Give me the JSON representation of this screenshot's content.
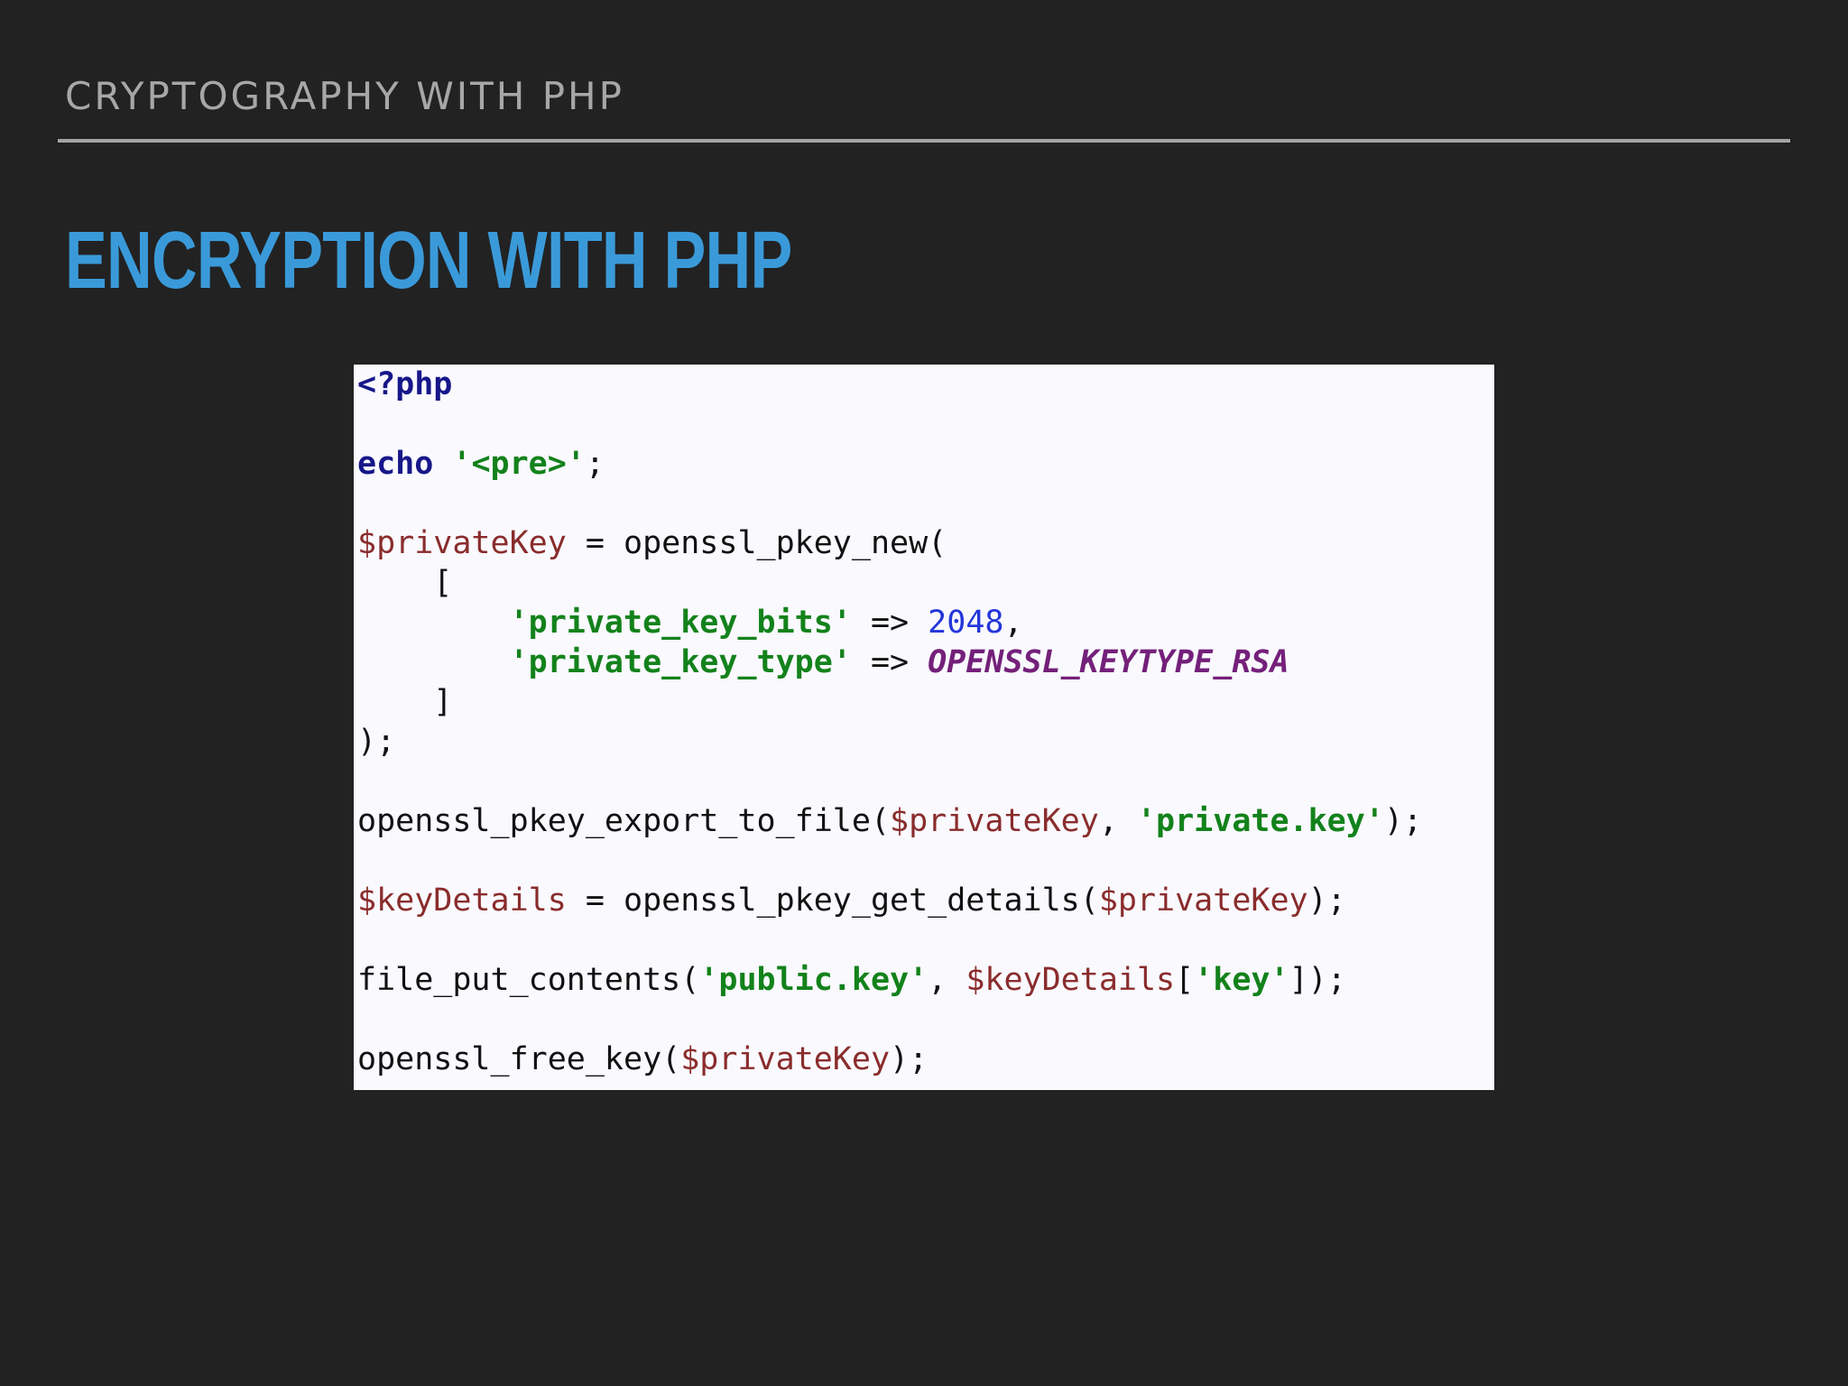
{
  "header": {
    "title": "CRYPTOGRAPHY WITH PHP"
  },
  "slide": {
    "title": "ENCRYPTION WITH PHP"
  },
  "code": {
    "language": "php",
    "lines": [
      [
        {
          "t": "<?php",
          "c": "kw"
        }
      ],
      [],
      [
        {
          "t": "echo",
          "c": "kw"
        },
        {
          "t": " ",
          "c": ""
        },
        {
          "t": "'<pre>'",
          "c": "str"
        },
        {
          "t": ";",
          "c": ""
        }
      ],
      [],
      [
        {
          "t": "$privateKey",
          "c": "var"
        },
        {
          "t": " = openssl_pkey_new(",
          "c": ""
        }
      ],
      [
        {
          "t": "    [",
          "c": ""
        }
      ],
      [
        {
          "t": "        ",
          "c": ""
        },
        {
          "t": "'private_key_bits'",
          "c": "str"
        },
        {
          "t": " => ",
          "c": ""
        },
        {
          "t": "2048",
          "c": "num"
        },
        {
          "t": ",",
          "c": ""
        }
      ],
      [
        {
          "t": "        ",
          "c": ""
        },
        {
          "t": "'private_key_type'",
          "c": "str"
        },
        {
          "t": " => ",
          "c": ""
        },
        {
          "t": "OPENSSL_KEYTYPE_RSA",
          "c": "const"
        }
      ],
      [
        {
          "t": "    ]",
          "c": ""
        }
      ],
      [
        {
          "t": ");",
          "c": ""
        }
      ],
      [],
      [
        {
          "t": "openssl_pkey_export_to_file(",
          "c": ""
        },
        {
          "t": "$privateKey",
          "c": "var"
        },
        {
          "t": ", ",
          "c": ""
        },
        {
          "t": "'private.key'",
          "c": "str"
        },
        {
          "t": ");",
          "c": ""
        }
      ],
      [],
      [
        {
          "t": "$keyDetails",
          "c": "var"
        },
        {
          "t": " = openssl_pkey_get_details(",
          "c": ""
        },
        {
          "t": "$privateKey",
          "c": "var"
        },
        {
          "t": ");",
          "c": ""
        }
      ],
      [],
      [
        {
          "t": "file_put_contents(",
          "c": ""
        },
        {
          "t": "'public.key'",
          "c": "str"
        },
        {
          "t": ", ",
          "c": ""
        },
        {
          "t": "$keyDetails",
          "c": "var"
        },
        {
          "t": "[",
          "c": ""
        },
        {
          "t": "'key'",
          "c": "str"
        },
        {
          "t": "]);",
          "c": ""
        }
      ],
      [],
      [
        {
          "t": "openssl_free_key(",
          "c": ""
        },
        {
          "t": "$privateKey",
          "c": "var"
        },
        {
          "t": ");",
          "c": ""
        }
      ]
    ]
  },
  "colors": {
    "background": "#222223",
    "header_text": "#a7a7a7",
    "title_accent": "#3a9ad9",
    "code_background": "#f9f9fe",
    "php_keyword": "#17178a",
    "php_string": "#13821b",
    "php_variable": "#8a2c2c",
    "php_number": "#2436d9",
    "php_constant": "#74207a"
  }
}
